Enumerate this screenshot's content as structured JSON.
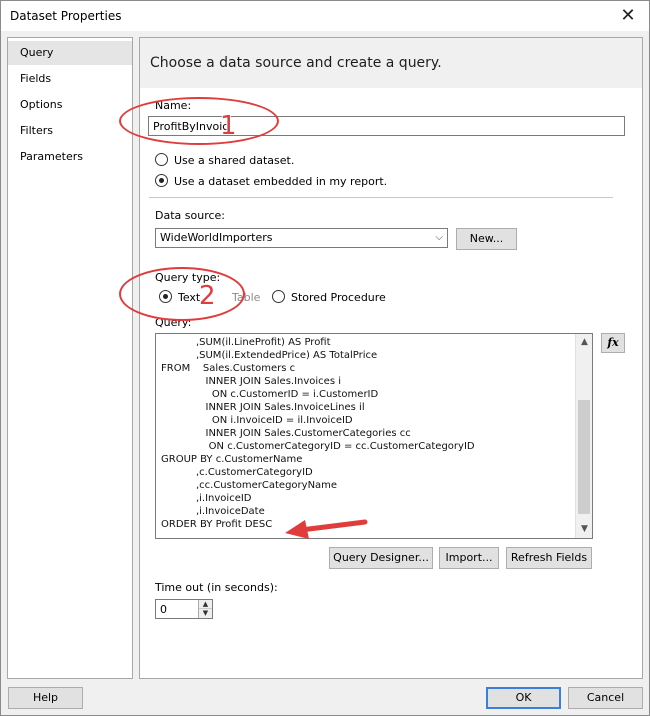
{
  "window": {
    "title": "Dataset Properties"
  },
  "nav": {
    "items": [
      {
        "label": "Query"
      },
      {
        "label": "Fields"
      },
      {
        "label": "Options"
      },
      {
        "label": "Filters"
      },
      {
        "label": "Parameters"
      }
    ]
  },
  "header": {
    "text": "Choose a data source and create a query."
  },
  "name_field": {
    "label": "Name:",
    "value": "ProfitByInvoic"
  },
  "dataset_type": {
    "shared_label": "Use a shared dataset.",
    "embedded_label": "Use a dataset embedded in my report.",
    "selected": "embedded"
  },
  "data_source": {
    "label": "Data source:",
    "value": "WideWorldImporters",
    "new_label": "New..."
  },
  "query_type": {
    "label": "Query type:",
    "options": [
      "Text",
      "Table",
      "Stored Procedure"
    ],
    "selected": "Text"
  },
  "query": {
    "label": "Query:",
    "lines": [
      "           ,SUM(il.LineProfit) AS Profit",
      "           ,SUM(il.ExtendedPrice) AS TotalPrice",
      "FROM    Sales.Customers c",
      "              INNER JOIN Sales.Invoices i",
      "                ON c.CustomerID = i.CustomerID",
      "              INNER JOIN Sales.InvoiceLines il",
      "                ON i.InvoiceID = il.InvoiceID",
      "              INNER JOIN Sales.CustomerCategories cc",
      "               ON c.CustomerCategoryID = cc.CustomerCategoryID",
      "GROUP BY c.CustomerName",
      "           ,c.CustomerCategoryID",
      "           ,cc.CustomerCategoryName",
      "           ,i.InvoiceID",
      "           ,i.InvoiceDate",
      "ORDER BY Profit DESC"
    ],
    "fx_label": "fx"
  },
  "buttons": {
    "query_designer": "Query Designer...",
    "import": "Import...",
    "refresh_fields": "Refresh Fields",
    "help": "Help",
    "ok": "OK",
    "cancel": "Cancel"
  },
  "timeout": {
    "label": "Time out (in seconds):",
    "value": "0"
  },
  "annotations": {
    "callout_1": "1",
    "callout_2": "2",
    "accent": "#e03c3c"
  }
}
